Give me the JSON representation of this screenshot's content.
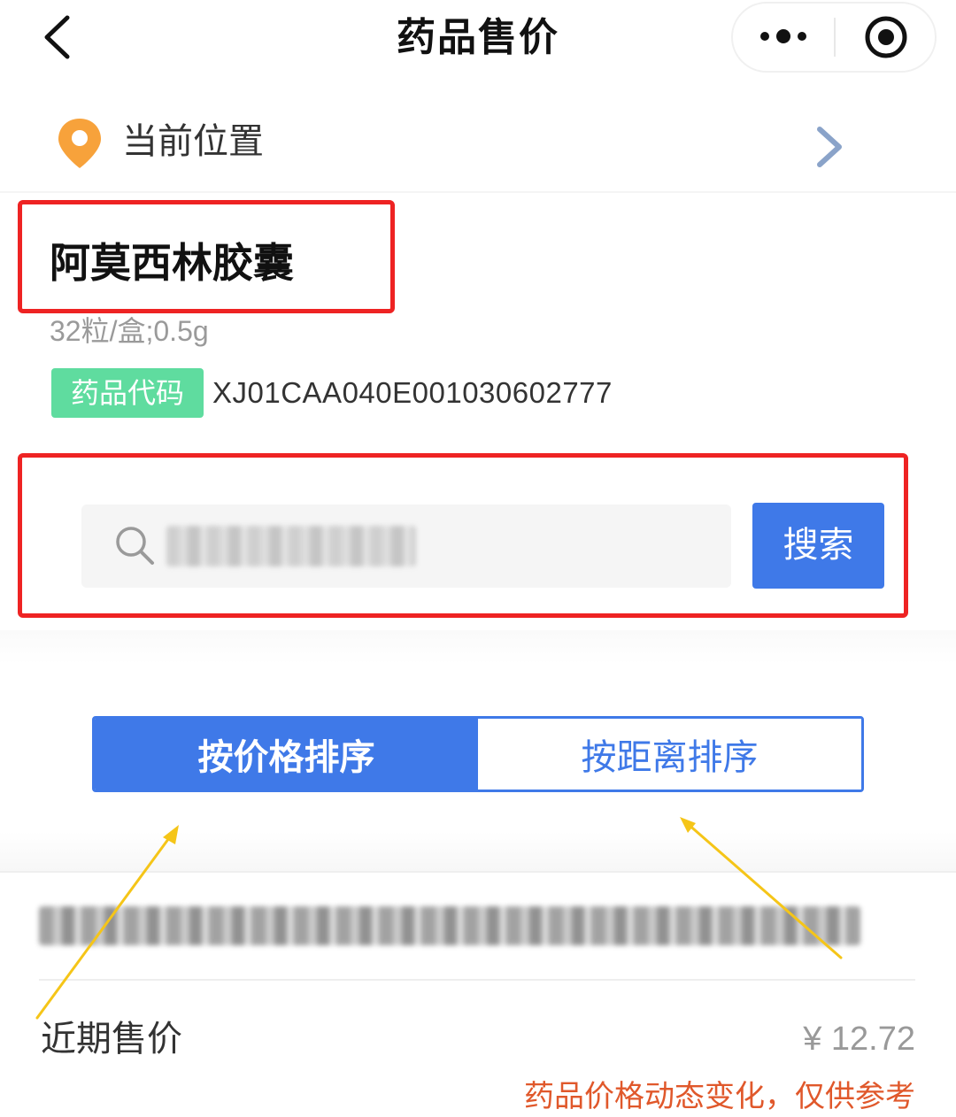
{
  "nav": {
    "title": "药品售价"
  },
  "location": {
    "label": "当前位置"
  },
  "drug": {
    "name": "阿莫西林胶囊",
    "spec": "32粒/盒;0.5g",
    "code_badge": "药品代码",
    "code_value": "XJ01CAA040E001030602777"
  },
  "search": {
    "button_label": "搜索"
  },
  "sort": {
    "by_price": "按价格排序",
    "by_distance": "按距离排序",
    "active": "by_price"
  },
  "result": {
    "price_label": "近期售价",
    "price_value": "¥ 12.72",
    "note": "药品价格动态变化，仅供参考"
  },
  "colors": {
    "primary_blue": "#3f79e8",
    "highlight_red": "#ee2323",
    "badge_green": "#5fdc9f",
    "pin_orange": "#f7a23b",
    "note_orange": "#e0582b",
    "arrow_yellow": "#f5c518"
  },
  "icons": {
    "back": "chevron-left-icon",
    "more": "more-dots-icon",
    "close": "target-circle-icon",
    "location": "map-pin-icon",
    "chevron": "chevron-right-icon",
    "search": "magnifier-icon"
  }
}
